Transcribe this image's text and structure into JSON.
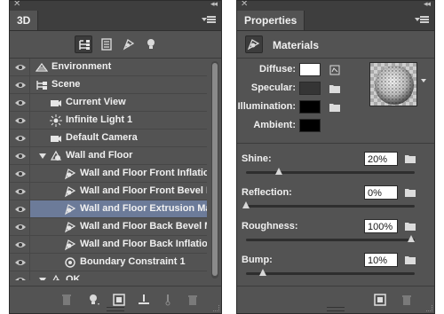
{
  "panel3d": {
    "tab_label": "3D",
    "rows": [
      {
        "label": "Environment",
        "icon": "environment-icon",
        "selected": false
      },
      {
        "label": "Scene",
        "icon": "scene-icon",
        "selected": false
      },
      {
        "label": "Current View",
        "icon": "camera-icon",
        "selected": false
      },
      {
        "label": "Infinite Light 1",
        "icon": "light-icon",
        "selected": false
      },
      {
        "label": "Default Camera",
        "icon": "camera-icon",
        "selected": false
      },
      {
        "label": "Wall and Floor",
        "icon": "mesh-icon",
        "selected": false
      },
      {
        "label": "Wall and Floor Front Inflatio...",
        "icon": "material-icon",
        "selected": false
      },
      {
        "label": "Wall and Floor Front Bevel M...",
        "icon": "material-icon",
        "selected": false
      },
      {
        "label": "Wall and Floor Extrusion Ma...",
        "icon": "material-icon",
        "selected": true
      },
      {
        "label": "Wall and Floor Back Bevel M...",
        "icon": "material-icon",
        "selected": false
      },
      {
        "label": "Wall and Floor Back Inflation...",
        "icon": "material-icon",
        "selected": false
      },
      {
        "label": "Boundary Constraint 1",
        "icon": "constraint-icon",
        "selected": false
      },
      {
        "label": "OK",
        "icon": "mesh-icon",
        "selected": false
      }
    ]
  },
  "properties": {
    "tab_label": "Properties",
    "section_title": "Materials",
    "colors": {
      "accent_selection": "#6c7b99",
      "panel_bg": "#535353"
    },
    "swatches": [
      {
        "label": "Diffuse:",
        "color": "#ffffff"
      },
      {
        "label": "Specular:",
        "color": "#353535"
      },
      {
        "label": "Illumination:",
        "color": "#000000"
      },
      {
        "label": "Ambient:",
        "color": "#000000"
      }
    ],
    "sliders": [
      {
        "label": "Shine:",
        "value": "20%",
        "level": 0.2
      },
      {
        "label": "Reflection:",
        "value": "0%",
        "level": 0.0
      },
      {
        "label": "Roughness:",
        "value": "100%",
        "level": 1.0
      },
      {
        "label": "Bump:",
        "value": "10%",
        "level": 0.1
      }
    ]
  }
}
